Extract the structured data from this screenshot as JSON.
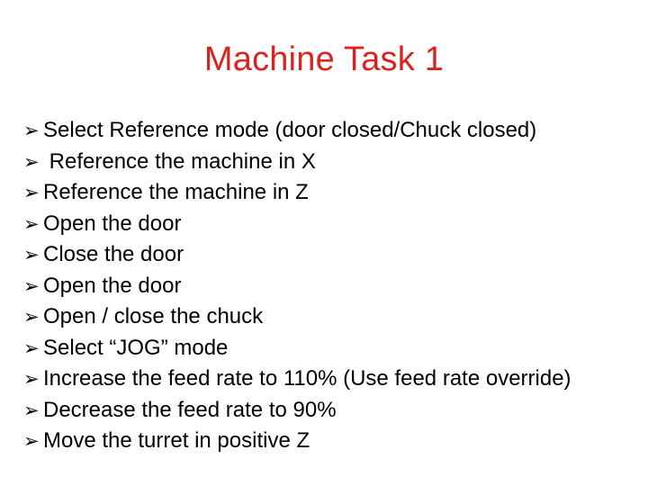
{
  "slide": {
    "title": "Machine Task 1",
    "title_color": "#d9231f",
    "background_color": "#ffffff",
    "text_color": "#000000",
    "bullet_glyph": "➢",
    "items": [
      {
        "marker": "➢",
        "text": "Select Reference mode (door closed/Chuck closed)"
      },
      {
        "marker": "➢",
        "text": " Reference the machine in X"
      },
      {
        "marker": "➢",
        "text": "Reference the machine in Z"
      },
      {
        "marker": "➢",
        "text": "Open the door"
      },
      {
        "marker": "➢",
        "text": "Close the door"
      },
      {
        "marker": "➢",
        "text": "Open the door"
      },
      {
        "marker": "➢",
        "text": "Open / close the chuck"
      },
      {
        "marker": "➢",
        "text": "Select “JOG” mode"
      },
      {
        "marker": "➢",
        "text": "Increase the feed rate to 110% (Use feed rate override)"
      },
      {
        "marker": "➢",
        "text": "Decrease the feed rate to 90%"
      },
      {
        "marker": "➢",
        "text": "Move the turret in positive Z"
      }
    ]
  }
}
